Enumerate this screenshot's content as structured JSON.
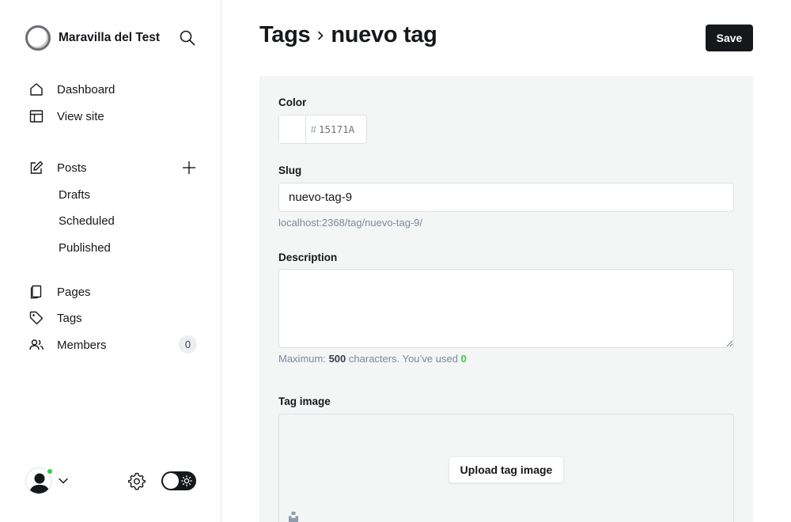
{
  "sidebar": {
    "site_name": "Maravilla del Test",
    "nav": {
      "dashboard": "Dashboard",
      "view_site": "View site",
      "posts": "Posts",
      "drafts": "Drafts",
      "scheduled": "Scheduled",
      "published": "Published",
      "pages": "Pages",
      "tags": "Tags",
      "members": "Members",
      "members_count": "0"
    }
  },
  "header": {
    "breadcrumb_parent": "Tags",
    "title": "nuevo tag",
    "save_label": "Save"
  },
  "form": {
    "color_label": "Color",
    "color_hash": "#",
    "color_placeholder": "15171A",
    "slug_label": "Slug",
    "slug_value": "nuevo-tag-9",
    "slug_url": "localhost:2368/tag/nuevo-tag-9/",
    "description_label": "Description",
    "description_value": "",
    "description_help_prefix": "Maximum:",
    "description_max": "500",
    "description_help_mid": "characters. You’ve used",
    "description_used": "0",
    "tag_image_label": "Tag image",
    "upload_label": "Upload tag image"
  },
  "colors": {
    "accent_dark": "#15171a",
    "status_online": "#30cf43",
    "panel_bg": "#f4f5f5"
  }
}
